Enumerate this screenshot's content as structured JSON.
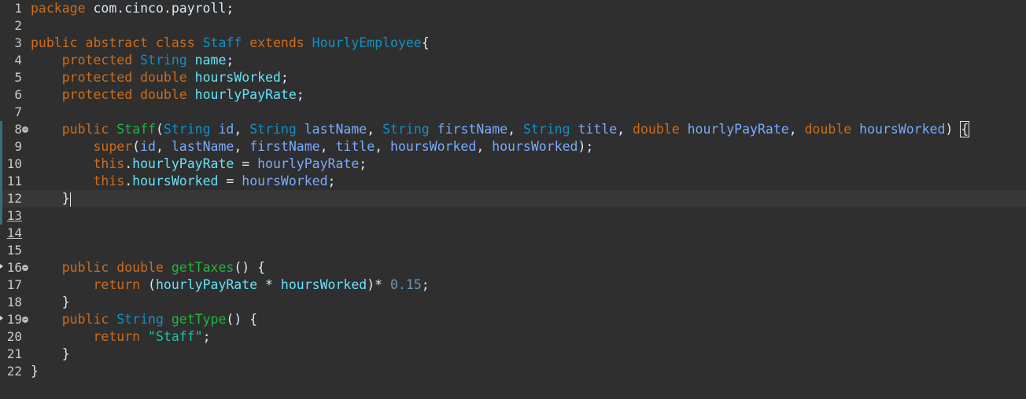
{
  "editor": {
    "language": "java",
    "current_line": 12,
    "lines": [
      {
        "n": "1",
        "segments": [
          [
            "kw",
            "package"
          ],
          [
            "plain",
            " com.cinco.payroll;"
          ]
        ]
      },
      {
        "n": "2",
        "segments": []
      },
      {
        "n": "3",
        "segments": [
          [
            "kw",
            "public"
          ],
          [
            "plain",
            " "
          ],
          [
            "kw",
            "abstract"
          ],
          [
            "plain",
            " "
          ],
          [
            "kw",
            "class"
          ],
          [
            "plain",
            " "
          ],
          [
            "cls",
            "Staff"
          ],
          [
            "plain",
            " "
          ],
          [
            "kw",
            "extends"
          ],
          [
            "plain",
            " "
          ],
          [
            "cls",
            "HourlyEmployee"
          ],
          [
            "plain",
            "{"
          ]
        ]
      },
      {
        "n": "4",
        "segments": [
          [
            "plain",
            "    "
          ],
          [
            "kw",
            "protected"
          ],
          [
            "plain",
            " "
          ],
          [
            "type",
            "String"
          ],
          [
            "plain",
            " "
          ],
          [
            "field",
            "name"
          ],
          [
            "plain",
            ";"
          ]
        ]
      },
      {
        "n": "5",
        "segments": [
          [
            "plain",
            "    "
          ],
          [
            "kw",
            "protected"
          ],
          [
            "plain",
            " "
          ],
          [
            "kw",
            "double"
          ],
          [
            "plain",
            " "
          ],
          [
            "field",
            "hoursWorked"
          ],
          [
            "plain",
            ";"
          ]
        ]
      },
      {
        "n": "6",
        "segments": [
          [
            "plain",
            "    "
          ],
          [
            "kw",
            "protected"
          ],
          [
            "plain",
            " "
          ],
          [
            "kw",
            "double"
          ],
          [
            "plain",
            " "
          ],
          [
            "field",
            "hourlyPayRate"
          ],
          [
            "plain",
            ";"
          ]
        ]
      },
      {
        "n": "7",
        "segments": []
      },
      {
        "n": "8",
        "fold": true,
        "changed": true,
        "segments": [
          [
            "plain",
            "    "
          ],
          [
            "kw",
            "public"
          ],
          [
            "plain",
            " "
          ],
          [
            "method",
            "Staff"
          ],
          [
            "plain",
            "("
          ],
          [
            "type",
            "String"
          ],
          [
            "plain",
            " "
          ],
          [
            "param",
            "id"
          ],
          [
            "plain",
            ", "
          ],
          [
            "type",
            "String"
          ],
          [
            "plain",
            " "
          ],
          [
            "param",
            "lastName"
          ],
          [
            "plain",
            ", "
          ],
          [
            "type",
            "String"
          ],
          [
            "plain",
            " "
          ],
          [
            "param",
            "firstName"
          ],
          [
            "plain",
            ", "
          ],
          [
            "type",
            "String"
          ],
          [
            "plain",
            " "
          ],
          [
            "param",
            "title"
          ],
          [
            "plain",
            ", "
          ],
          [
            "kw",
            "double"
          ],
          [
            "plain",
            " "
          ],
          [
            "param",
            "hourlyPayRate"
          ],
          [
            "plain",
            ", "
          ],
          [
            "kw",
            "double"
          ],
          [
            "plain",
            " "
          ],
          [
            "param",
            "hoursWorked"
          ],
          [
            "plain",
            ") "
          ],
          [
            "box",
            "{"
          ]
        ]
      },
      {
        "n": "9",
        "changed": true,
        "segments": [
          [
            "plain",
            "        "
          ],
          [
            "kw",
            "super"
          ],
          [
            "plain",
            "("
          ],
          [
            "param",
            "id"
          ],
          [
            "plain",
            ", "
          ],
          [
            "param",
            "lastName"
          ],
          [
            "plain",
            ", "
          ],
          [
            "param",
            "firstName"
          ],
          [
            "plain",
            ", "
          ],
          [
            "param",
            "title"
          ],
          [
            "plain",
            ", "
          ],
          [
            "param",
            "hoursWorked"
          ],
          [
            "plain",
            ", "
          ],
          [
            "param",
            "hoursWorked"
          ],
          [
            "plain",
            ");"
          ]
        ]
      },
      {
        "n": "10",
        "changed": true,
        "segments": [
          [
            "plain",
            "        "
          ],
          [
            "kw",
            "this"
          ],
          [
            "plain",
            "."
          ],
          [
            "field",
            "hourlyPayRate"
          ],
          [
            "plain",
            " = "
          ],
          [
            "param",
            "hourlyPayRate"
          ],
          [
            "plain",
            ";"
          ]
        ]
      },
      {
        "n": "11",
        "changed": true,
        "segments": [
          [
            "plain",
            "        "
          ],
          [
            "kw",
            "this"
          ],
          [
            "plain",
            "."
          ],
          [
            "field",
            "hoursWorked"
          ],
          [
            "plain",
            " = "
          ],
          [
            "param",
            "hoursWorked"
          ],
          [
            "plain",
            ";"
          ]
        ]
      },
      {
        "n": "12",
        "changed": true,
        "current": true,
        "segments": [
          [
            "plain",
            "    "
          ],
          [
            "plain",
            "}"
          ],
          [
            "caret",
            ""
          ]
        ]
      },
      {
        "n": "13",
        "changed": true,
        "underline": true,
        "segments": []
      },
      {
        "n": "14",
        "underline": true,
        "segments": []
      },
      {
        "n": "15",
        "segments": []
      },
      {
        "n": "16",
        "fold": true,
        "override": true,
        "segments": [
          [
            "plain",
            "    "
          ],
          [
            "kw",
            "public"
          ],
          [
            "plain",
            " "
          ],
          [
            "kw",
            "double"
          ],
          [
            "plain",
            " "
          ],
          [
            "method",
            "getTaxes"
          ],
          [
            "plain",
            "() {"
          ]
        ]
      },
      {
        "n": "17",
        "segments": [
          [
            "plain",
            "        "
          ],
          [
            "kw",
            "return"
          ],
          [
            "plain",
            " ("
          ],
          [
            "field",
            "hourlyPayRate"
          ],
          [
            "plain",
            " * "
          ],
          [
            "field",
            "hoursWorked"
          ],
          [
            "plain",
            ")* "
          ],
          [
            "num",
            "0.15"
          ],
          [
            "plain",
            ";"
          ]
        ]
      },
      {
        "n": "18",
        "segments": [
          [
            "plain",
            "    }"
          ]
        ]
      },
      {
        "n": "19",
        "fold": true,
        "override": true,
        "segments": [
          [
            "plain",
            "    "
          ],
          [
            "kw",
            "public"
          ],
          [
            "plain",
            " "
          ],
          [
            "type",
            "String"
          ],
          [
            "plain",
            " "
          ],
          [
            "method",
            "getType"
          ],
          [
            "plain",
            "() {"
          ]
        ]
      },
      {
        "n": "20",
        "segments": [
          [
            "plain",
            "        "
          ],
          [
            "kw",
            "return"
          ],
          [
            "plain",
            " "
          ],
          [
            "str",
            "\"Staff\""
          ],
          [
            "plain",
            ";"
          ]
        ]
      },
      {
        "n": "21",
        "segments": [
          [
            "plain",
            "    }"
          ]
        ]
      },
      {
        "n": "22",
        "segments": [
          [
            "plain",
            "}"
          ]
        ]
      }
    ]
  }
}
